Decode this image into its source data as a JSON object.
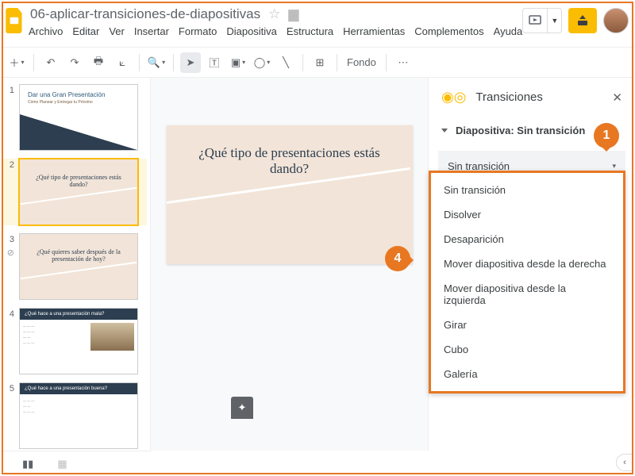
{
  "doc": {
    "title": "06-aplicar-transiciones-de-diapositivas"
  },
  "menus": [
    "Archivo",
    "Editar",
    "Ver",
    "Insertar",
    "Formato",
    "Diapositiva",
    "Estructura",
    "Herramientas",
    "Complementos",
    "Ayuda"
  ],
  "toolbar": {
    "background_label": "Fondo"
  },
  "markers": {
    "one": "1",
    "four": "4"
  },
  "panel": {
    "title": "Transiciones",
    "section": "Diapositiva: Sin transición",
    "selected": "Sin transición"
  },
  "transitions": [
    "Sin transición",
    "Disolver",
    "Desaparición",
    "Mover diapositiva desde la derecha",
    "Mover diapositiva desde la izquierda",
    "Girar",
    "Cubo",
    "Galería"
  ],
  "slides": {
    "s1": {
      "num": "1",
      "title": "Dar una Gran Presentación",
      "sub": "Cómo Planear y Entregar tu Próximo"
    },
    "s2": {
      "num": "2",
      "title": "¿Qué tipo de presentaciones estás dando?"
    },
    "s3": {
      "num": "3",
      "title": "¿Qué quieres saber después de la presentación de hoy?"
    },
    "s4": {
      "num": "4",
      "title": "¿Qué hace a una presentación mala?"
    },
    "s5": {
      "num": "5",
      "title": "¿Qué hace a una presentación buena?"
    }
  },
  "canvas": {
    "title": "¿Qué tipo de presentaciones estás dando?"
  }
}
